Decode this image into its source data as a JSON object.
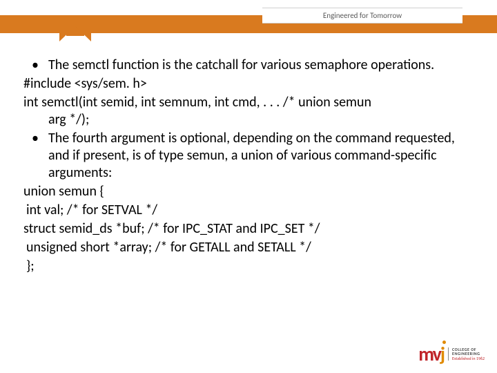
{
  "header": {
    "tagline": "Engineered for Tomorrow"
  },
  "content": {
    "lines": [
      {
        "type": "bullet",
        "text": "The semctl function is the catchall for various semaphore operations."
      },
      {
        "type": "plain",
        "text": "#include <sys/sem. h>"
      },
      {
        "type": "plain",
        "text": "int semctl(int semid, int semnum, int cmd, . . . /* union semun arg */);",
        "indentSecond": true
      },
      {
        "type": "bullet",
        "text": "The fourth argument is optional, depending on the command requested, and if present, is of type semun, a union of various command-specific arguments:"
      },
      {
        "type": "plain",
        "text": "union semun {"
      },
      {
        "type": "plain",
        "text": " int val; /* for SETVAL */"
      },
      {
        "type": "plain",
        "text": "struct semid_ds *buf; /* for IPC_STAT and IPC_SET */"
      },
      {
        "type": "plain",
        "text": " unsigned short *array; /* for GETALL and SETALL */"
      },
      {
        "type": "plain",
        "text": " };"
      }
    ]
  },
  "logo": {
    "mark": {
      "m": "m",
      "v": "v",
      "j": "j"
    },
    "text": {
      "l1": "COLLEGE OF",
      "l2": "ENGINEERING",
      "l3": "Established in 1962"
    }
  }
}
